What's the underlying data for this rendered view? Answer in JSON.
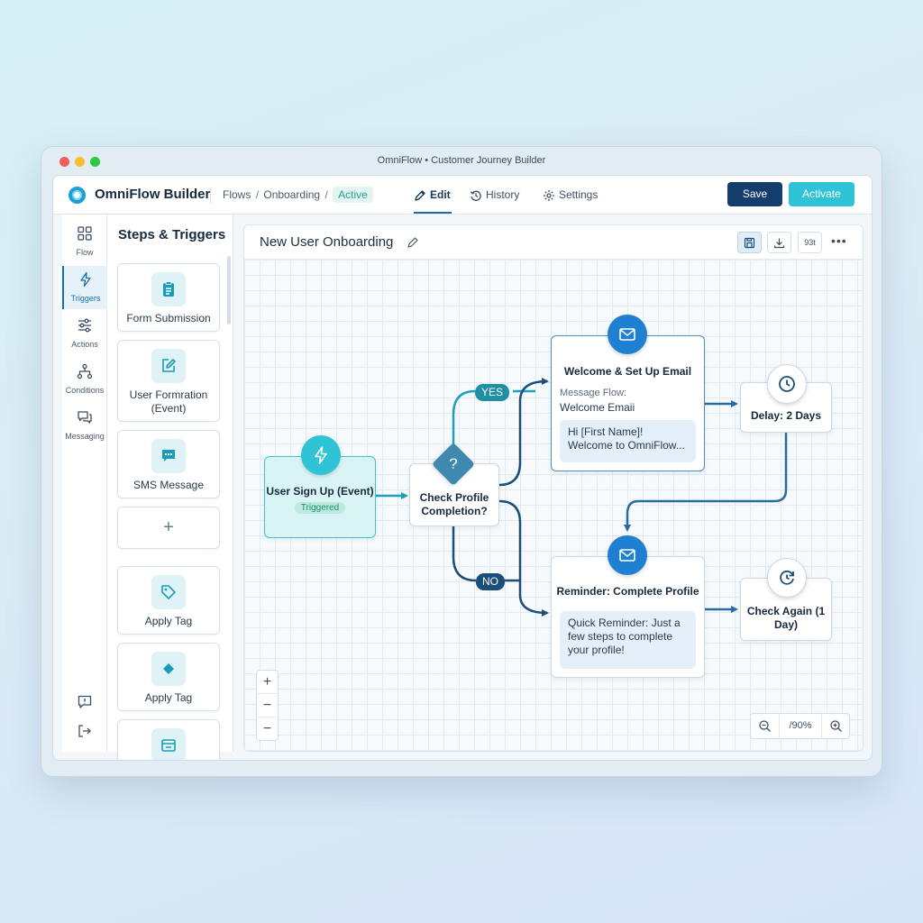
{
  "window": {
    "title": "OmniFlow • Customer Journey Builder"
  },
  "header": {
    "app_name": "OmniFlow Builder",
    "breadcrumb": [
      "Flows",
      "Onboarding",
      "Active"
    ],
    "tabs": [
      {
        "label": "Edit",
        "icon": "pencil-icon"
      },
      {
        "label": "History",
        "icon": "history-icon"
      },
      {
        "label": "Settings",
        "icon": "gear-icon"
      }
    ],
    "save_label": "Save",
    "activate_label": "Activate"
  },
  "iconbar": {
    "items": [
      {
        "label": "Flow",
        "icon": "grid-icon"
      },
      {
        "label": "Triggers",
        "icon": "lightning-icon",
        "active": true
      },
      {
        "label": "Actions",
        "icon": "sliders-icon"
      },
      {
        "label": "Conditions",
        "icon": "branch-icon"
      },
      {
        "label": "Messaging",
        "icon": "chat-icon"
      }
    ]
  },
  "steps": {
    "title": "Steps & Triggers",
    "cards": [
      {
        "label": "Form Submission",
        "icon": "clipboard-icon"
      },
      {
        "label": "User Formration (Event)",
        "icon": "edit-icon"
      },
      {
        "label": "SMS Message",
        "icon": "sms-icon"
      },
      {
        "label": "+",
        "icon": "plus-icon"
      },
      {
        "label": "Apply Tag",
        "icon": "tag-icon"
      },
      {
        "label": "Apply Tag",
        "icon": "tag-filled-icon"
      }
    ]
  },
  "canvas": {
    "flow_title": "New User Onboarding",
    "tool_text": "93t",
    "zoom_value": "/90%",
    "nodes": {
      "signup": {
        "title": "User Sign Up (Event)",
        "badge": "Triggered"
      },
      "check": {
        "title": "Check Profile Completion?"
      },
      "welcome": {
        "title": "Welcome & Set Up Email",
        "meta_label": "Message Flow:",
        "meta_value": "Welcome Emaii",
        "preview": "Hi [First Name]! Welcome to OmniFlow..."
      },
      "delay": {
        "title": "Delay: 2 Days"
      },
      "reminder": {
        "title": "Reminder: Complete Profile",
        "preview": "Quick Reminder: Just a few steps to complete your profile!"
      },
      "again": {
        "title": "Check Again (1 Day)"
      }
    },
    "edge_labels": {
      "yes": "YES",
      "no": "NO"
    }
  },
  "colors": {
    "primary_dark": "#133d6a",
    "accent_cyan": "#2ec4d6",
    "email_blue": "#1f7fd1",
    "active_green": "#1fa58e"
  }
}
